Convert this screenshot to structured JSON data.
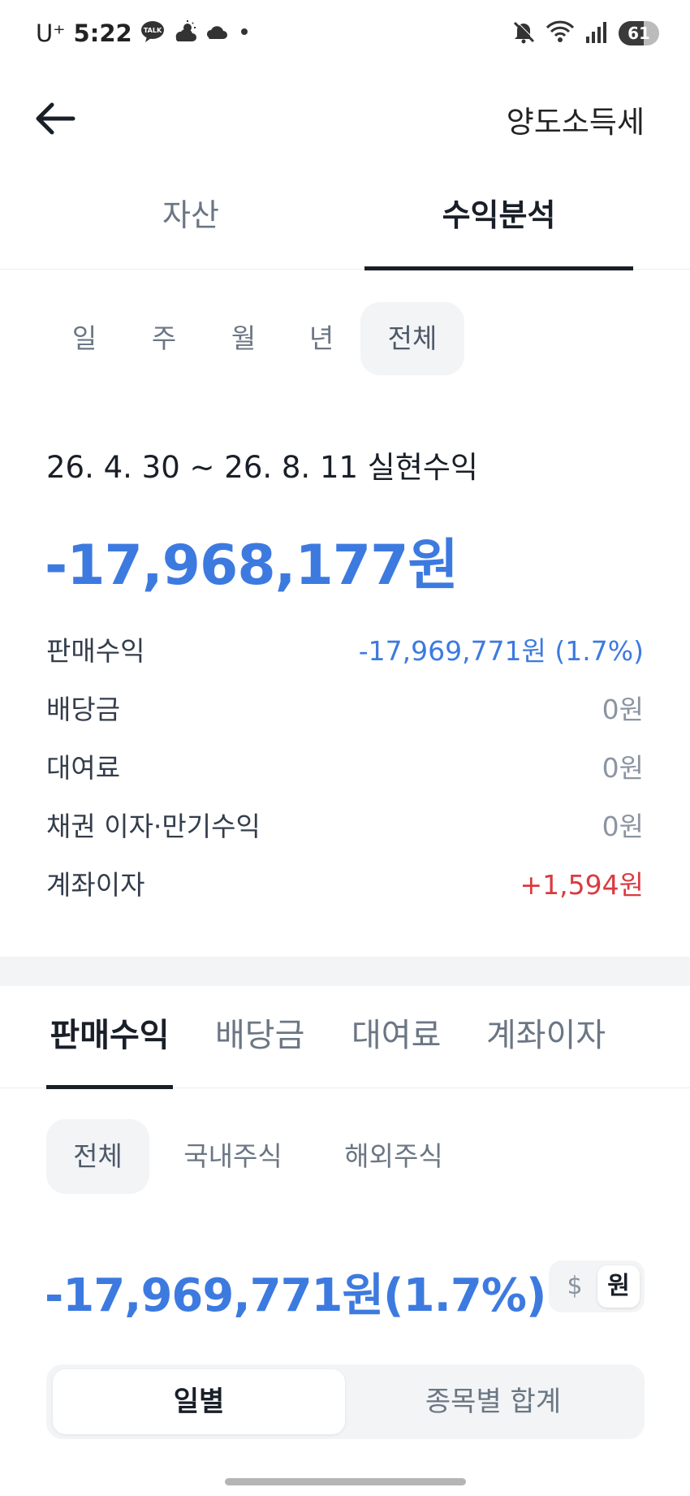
{
  "status_bar": {
    "carrier": "U⁺",
    "time": "5:22",
    "talk_badge": "TALK",
    "battery_level": "61",
    "battery_fraction": 0.61
  },
  "header": {
    "title": "양도소득세"
  },
  "main_tabs": [
    {
      "label": "자산",
      "active": false
    },
    {
      "label": "수익분석",
      "active": true
    }
  ],
  "period_filters": [
    {
      "label": "일",
      "selected": false
    },
    {
      "label": "주",
      "selected": false
    },
    {
      "label": "월",
      "selected": false
    },
    {
      "label": "년",
      "selected": false
    },
    {
      "label": "전체",
      "selected": true
    }
  ],
  "summary": {
    "range_title": "26. 4. 30 ~ 26. 8. 11 실현수익",
    "total_amount": "-17,968,177원",
    "breakdown": [
      {
        "label": "판매수익",
        "value": "-17,969,771원 (1.7%)",
        "tone": "negative"
      },
      {
        "label": "배당금",
        "value": "0원",
        "tone": "neutral"
      },
      {
        "label": "대여료",
        "value": "0원",
        "tone": "neutral"
      },
      {
        "label": "채권 이자·만기수익",
        "value": "0원",
        "tone": "neutral"
      },
      {
        "label": "계좌이자",
        "value": "+1,594원",
        "tone": "positive"
      }
    ]
  },
  "sub_tabs": [
    {
      "label": "판매수익",
      "active": true
    },
    {
      "label": "배당금",
      "active": false
    },
    {
      "label": "대여료",
      "active": false
    },
    {
      "label": "계좌이자",
      "active": false
    }
  ],
  "market_filters": [
    {
      "label": "전체",
      "selected": true
    },
    {
      "label": "국내주식",
      "selected": false
    },
    {
      "label": "해외주식",
      "selected": false
    }
  ],
  "sale_total": "-17,969,771원(1.7%)",
  "currency_toggle": {
    "usd_label": "$",
    "krw_label": "원",
    "selected": "원"
  },
  "view_toggle": {
    "daily_label": "일별",
    "by_stock_label": "종목별 합계",
    "selected": "일별"
  },
  "colors": {
    "negative": "#3d7ae0",
    "positive": "#d93b40",
    "neutral": "#8b95a1",
    "chip_bg": "#f2f4f6"
  }
}
